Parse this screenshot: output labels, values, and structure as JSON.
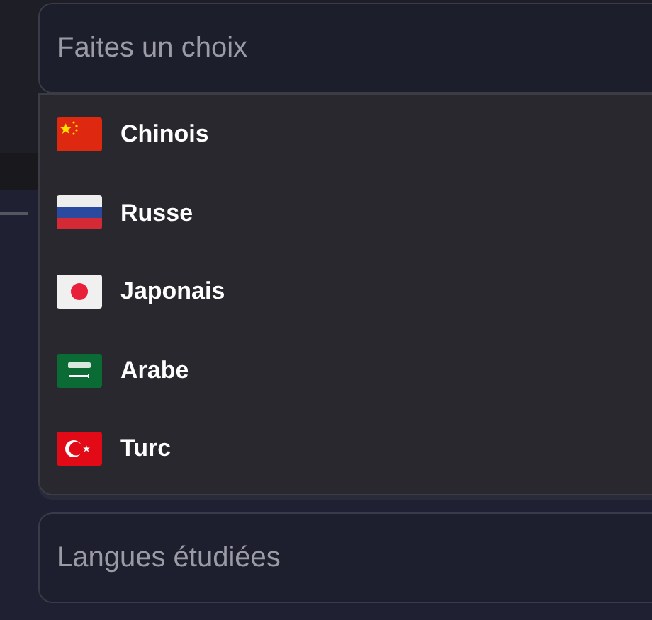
{
  "select": {
    "placeholder": "Faites un choix"
  },
  "options": [
    {
      "label": "Chinois"
    },
    {
      "label": "Russe"
    },
    {
      "label": "Japonais"
    },
    {
      "label": "Arabe"
    },
    {
      "label": "Turc"
    }
  ],
  "languages_field": {
    "placeholder": "Langues étudiées"
  }
}
